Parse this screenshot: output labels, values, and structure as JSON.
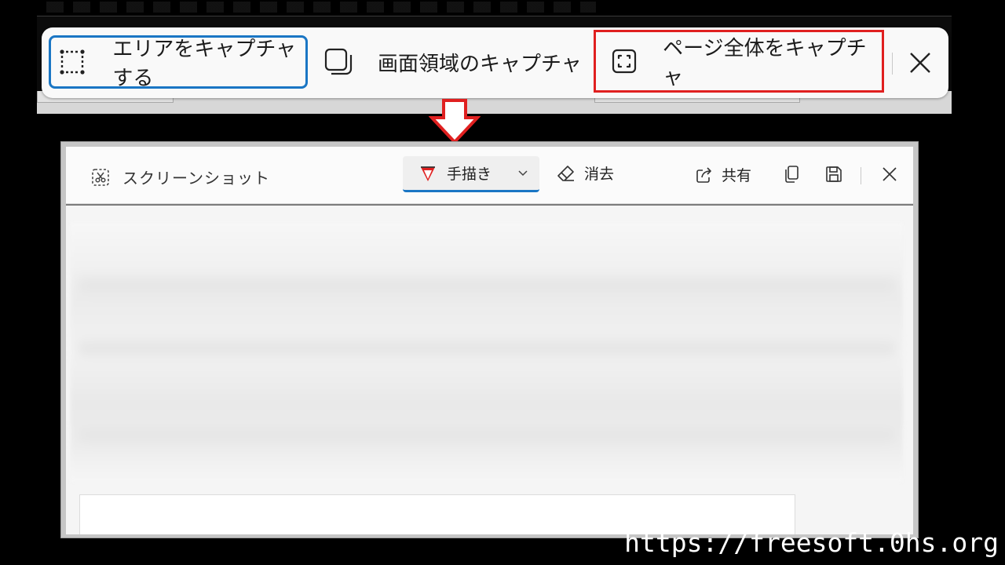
{
  "capture_toolbar": {
    "area_label": "エリアをキャプチャする",
    "window_label": "画面領域のキャプチャ",
    "fullpage_label": "ページ全体をキャプチャ",
    "close_icon": "close-icon",
    "highlight_colors": {
      "area_border": "#1a76c4",
      "fullpage_border": "#e02020"
    }
  },
  "arrow": {
    "color": "#e02020",
    "icon": "down-arrow-icon"
  },
  "editor": {
    "title": "スクリーンショット",
    "draw_label": "手描き",
    "erase_label": "消去",
    "share_label": "共有",
    "accent": "#1a76c4"
  },
  "watermark": "https://freesoft.0hs.org"
}
